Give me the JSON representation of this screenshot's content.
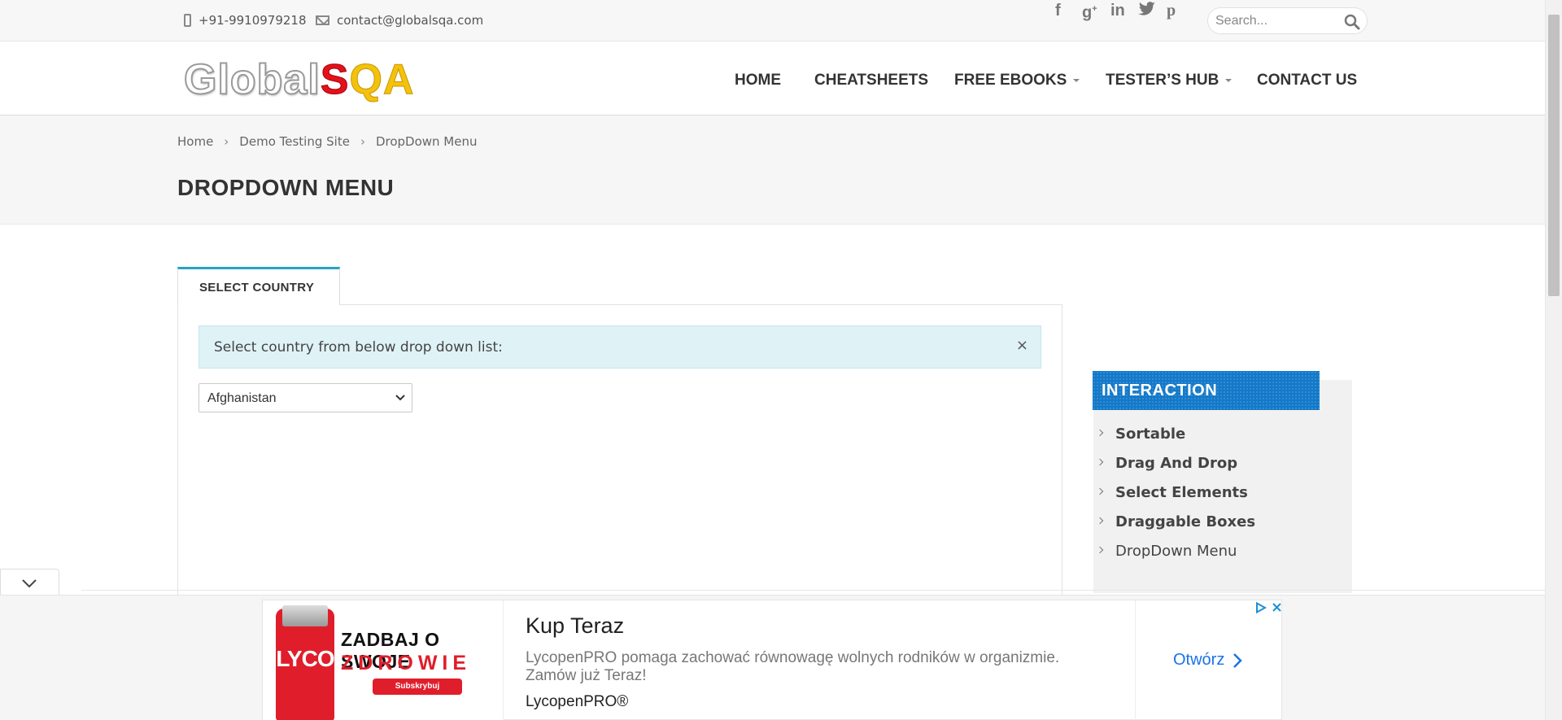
{
  "topbar": {
    "phone": "+91-9910979218",
    "email": "contact@globalsqa.com",
    "social_icons": [
      "facebook-icon",
      "google-plus-icon",
      "linkedin-icon",
      "twitter-icon",
      "pinterest-icon"
    ],
    "search_placeholder": "Search..."
  },
  "header": {
    "logo_part1": "Global",
    "logo_part2": "S",
    "logo_part3": "QA",
    "nav": {
      "home": "HOME",
      "cheatsheets": "CHEATSHEETS",
      "free_ebooks": "FREE EBOOKS",
      "testers_hub": "TESTER’S HUB",
      "contact_us": "CONTACT US"
    }
  },
  "breadcrumb": {
    "home": "Home",
    "demo": "Demo Testing Site",
    "current": "DropDown Menu"
  },
  "page_title": "DROPDOWN MENU",
  "main": {
    "tab_label": "SELECT COUNTRY",
    "alert_text": "Select country from below drop down list:",
    "alert_close": "×",
    "select_value": "Afghanistan"
  },
  "sidebar": {
    "heading": "INTERACTION",
    "items": [
      {
        "label": "Sortable"
      },
      {
        "label": "Drag And Drop"
      },
      {
        "label": "Select Elements"
      },
      {
        "label": "Draggable Boxes"
      },
      {
        "label": "DropDown Menu"
      }
    ]
  },
  "ad": {
    "image_brand": "LYCO",
    "image_headline1": "ZADBAJ O SWOJE",
    "image_headline2": "ZDROWIE",
    "image_button": "Subskrybuj",
    "title": "Kup Teraz",
    "description": "LycopenPRO pomaga zachować równowagę wolnych rodników w organizmie. Zamów już Teraz!",
    "advertiser": "LycopenPRO®",
    "cta": "Otwórz"
  },
  "colors": {
    "accent": "#24a3c7",
    "sidebar_head": "#1379c9",
    "alert_bg": "#dff2f6",
    "logo_red": "#e3111b",
    "logo_yellow": "#f4c20d",
    "ad_link": "#1a73e8"
  }
}
